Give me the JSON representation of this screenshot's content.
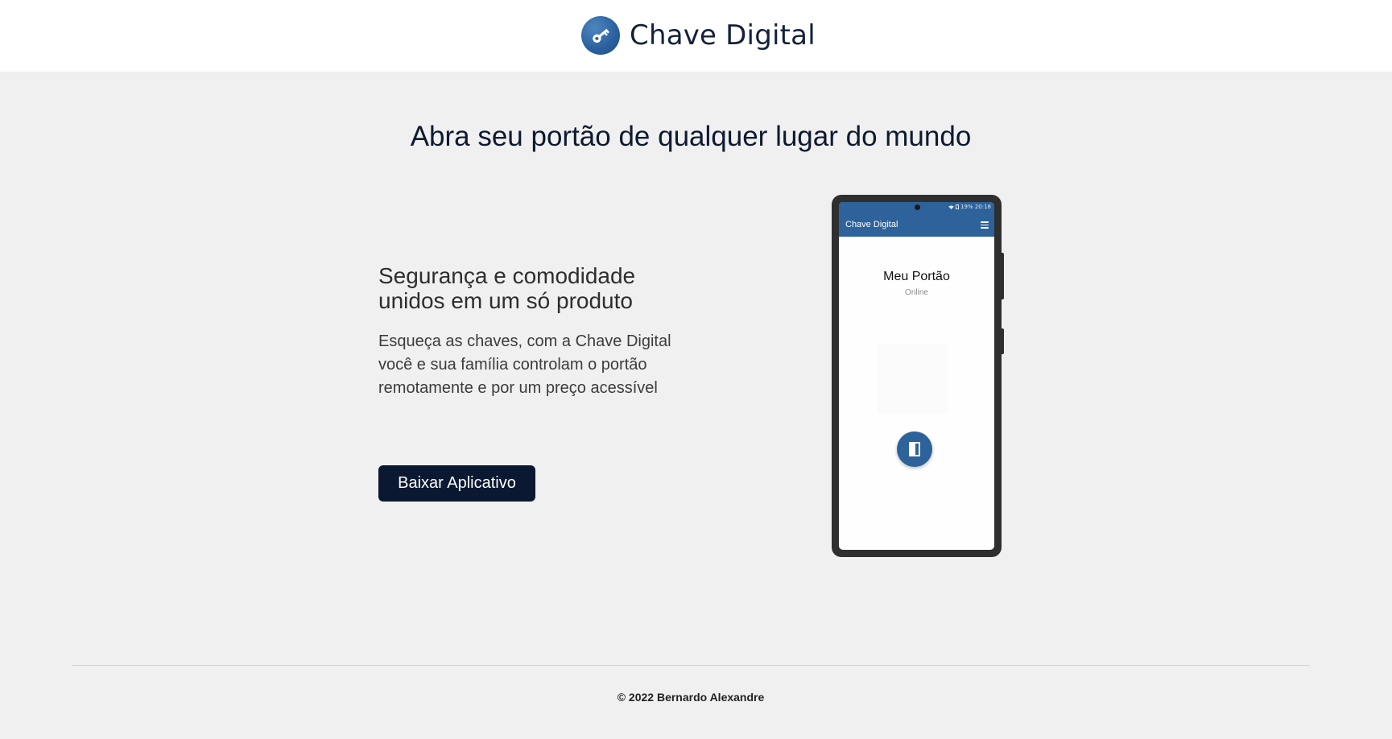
{
  "colors": {
    "brand_blue": "#2d629b",
    "button_dark": "#0a1931",
    "background": "#f0f0f0",
    "header_bg": "#ffffff"
  },
  "header": {
    "logo_icon": "key-icon",
    "brand_name": "Chave Digital"
  },
  "hero": {
    "title": "Abra seu portão de qualquer lugar do mundo",
    "subtitle_line1": "Segurança e comodidade",
    "subtitle_line2": "unidos em um só produto",
    "description_line1": "Esqueça as chaves, com a Chave Digital",
    "description_line2": "você e sua família controlam o portão",
    "description_line3": "remotamente e por um preço acessível",
    "download_label": "Baixar Aplicativo"
  },
  "phone": {
    "status_text": "19% 20:18",
    "app_title": "Chave Digital",
    "menu_icon": "hamburger-menu-icon",
    "device_name": "Meu Portão",
    "device_status": "Online",
    "open_icon": "door-icon"
  },
  "footer": {
    "copyright": "© 2022 Bernardo Alexandre"
  }
}
